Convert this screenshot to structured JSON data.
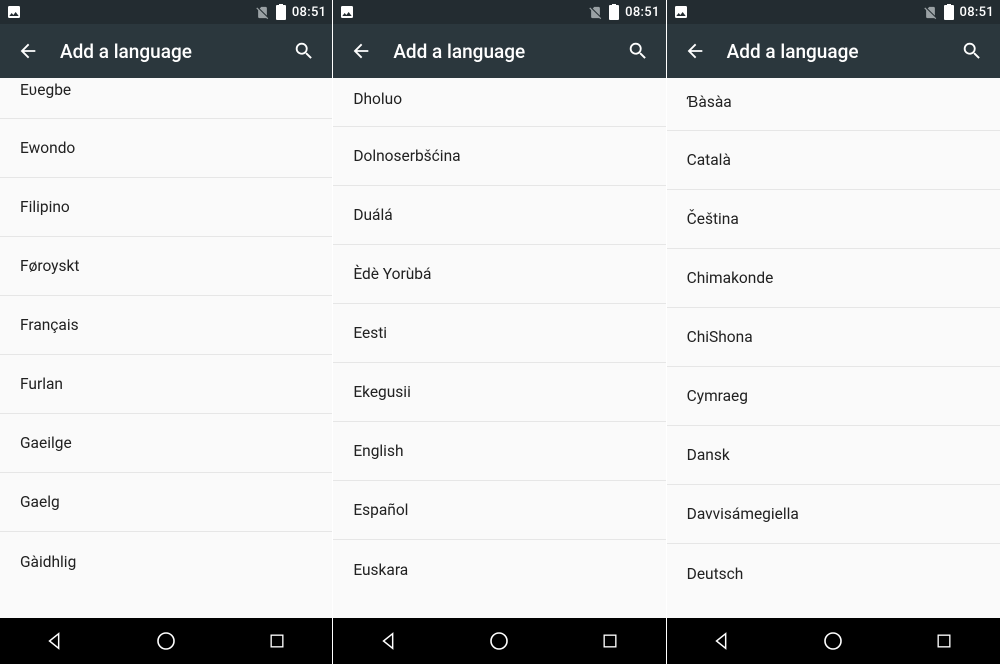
{
  "status": {
    "time": "08:51"
  },
  "appbar": {
    "title": "Add a language"
  },
  "screens": [
    {
      "listClass": "offset1",
      "languages": [
        "Eʋegbe",
        "Ewondo",
        "Filipino",
        "Føroyskt",
        "Français",
        "Furlan",
        "Gaeilge",
        "Gaelg",
        "Gàidhlig"
      ]
    },
    {
      "listClass": "offset2",
      "languages": [
        "Dholuo",
        "Dolnoserbšćina",
        "Duálá",
        "Èdè Yorùbá",
        "Eesti",
        "Ekegusii",
        "English",
        "Español",
        "Euskara"
      ]
    },
    {
      "listClass": "offset3",
      "languages": [
        "Ɓàsàa",
        "Català",
        "Čeština",
        "Chimakonde",
        "ChiShona",
        "Cymraeg",
        "Dansk",
        "Davvisámegiella",
        "Deutsch"
      ]
    }
  ]
}
